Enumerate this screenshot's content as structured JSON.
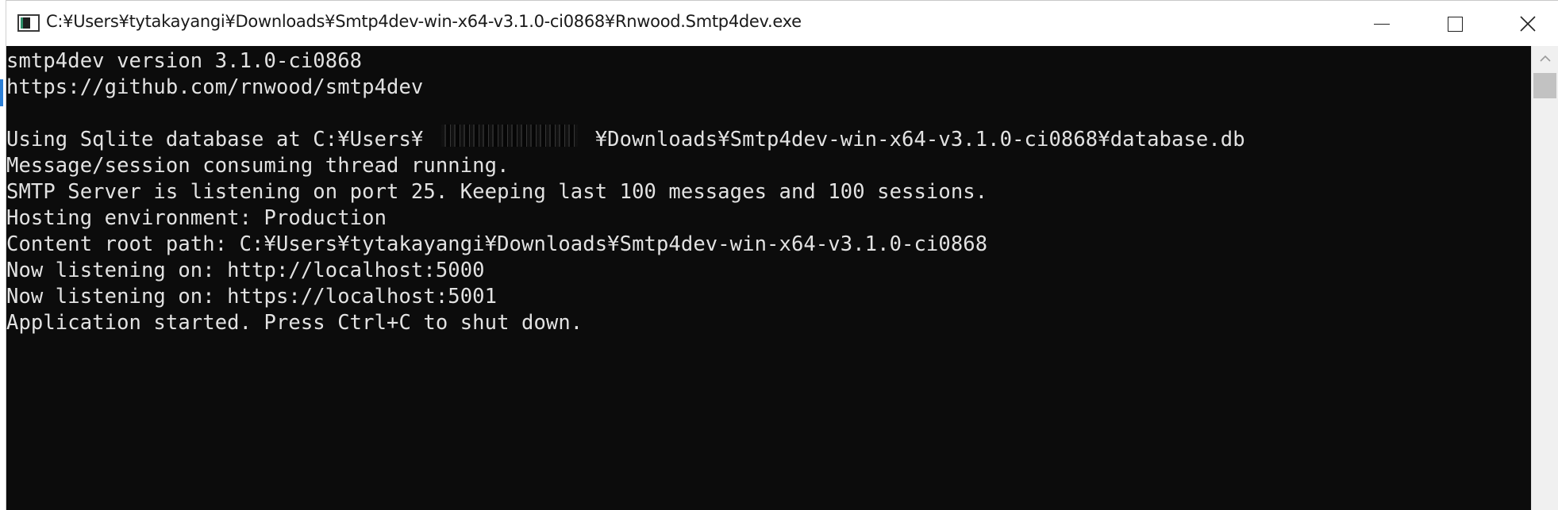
{
  "window": {
    "title": "C:¥Users¥tytakayangi¥Downloads¥Smtp4dev-win-x64-v3.1.0-ci0868¥Rnwood.Smtp4dev.exe",
    "icon": "console-app-icon",
    "buttons": {
      "minimize": "minimize-icon",
      "maximize": "maximize-icon",
      "close": "close-icon"
    }
  },
  "console": {
    "background": "#0c0c0c",
    "foreground": "#e2e2e2",
    "lines": [
      "smtp4dev version 3.1.0-ci0868",
      "https://github.com/rnwood/smtp4dev",
      "",
      "Using Sqlite database at C:¥Users¥              ¥Downloads¥Smtp4dev-win-x64-v3.1.0-ci0868¥database.db",
      "Message/session consuming thread running.",
      "SMTP Server is listening on port 25. Keeping last 100 messages and 100 sessions.",
      "Hosting environment: Production",
      "Content root path: C:¥Users¥tytakayangi¥Downloads¥Smtp4dev-win-x64-v3.1.0-ci0868",
      "Now listening on: http://localhost:5000",
      "Now listening on: https://localhost:5001",
      "Application started. Press Ctrl+C to shut down."
    ]
  },
  "scrollbar": {
    "up_arrow": "chevron-up-icon"
  }
}
